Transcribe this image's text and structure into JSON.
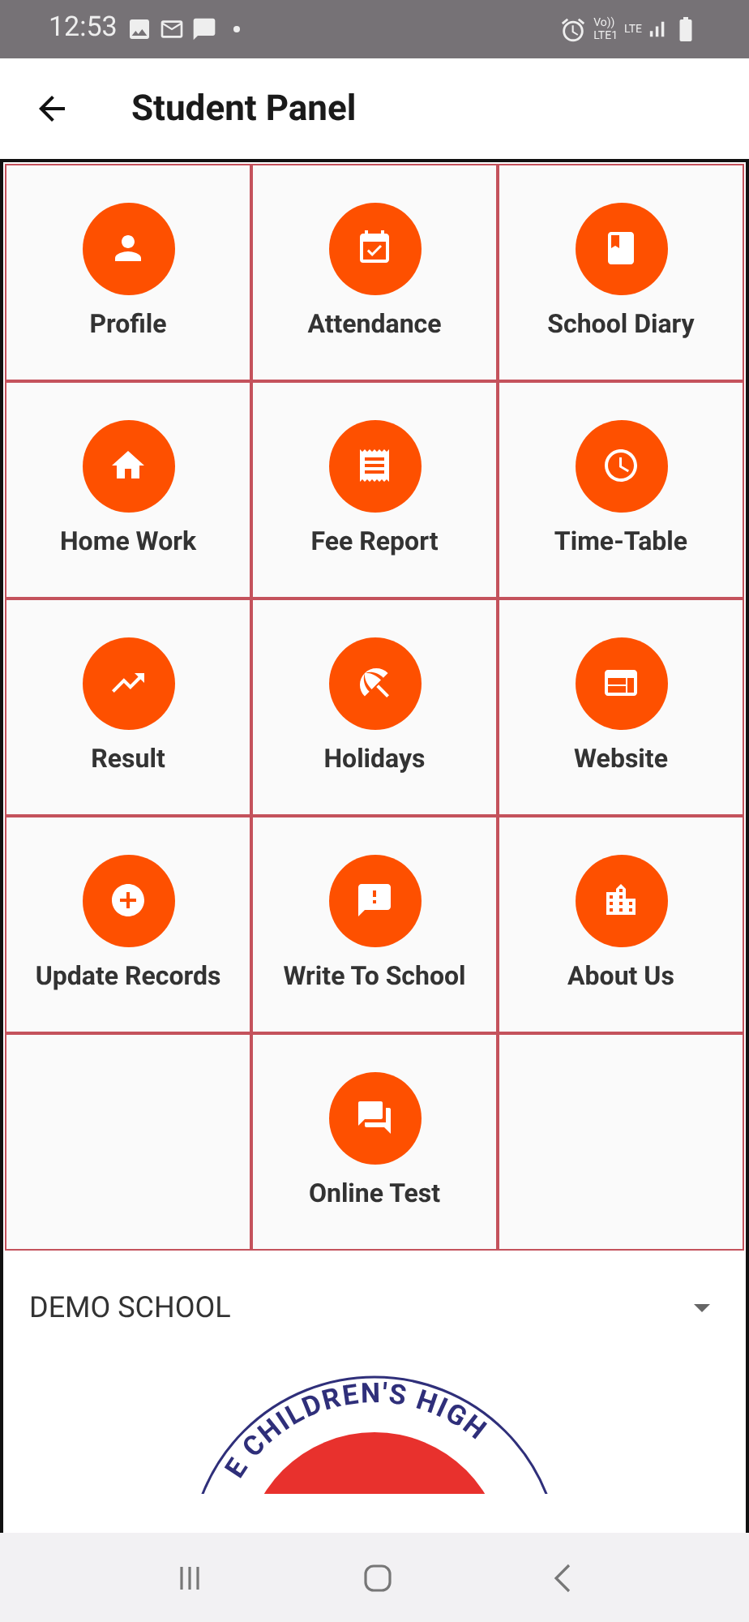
{
  "status_bar": {
    "time": "12:53",
    "network_1": "Vo))\nLTE1",
    "network_2": "LTE"
  },
  "header": {
    "title": "Student Panel"
  },
  "tiles": [
    {
      "label": "Profile"
    },
    {
      "label": "Attendance"
    },
    {
      "label": "School Diary"
    },
    {
      "label": "Home Work"
    },
    {
      "label": "Fee Report"
    },
    {
      "label": "Time-Table"
    },
    {
      "label": "Result"
    },
    {
      "label": "Holidays"
    },
    {
      "label": "Website"
    },
    {
      "label": "Update Records"
    },
    {
      "label": "Write To School"
    },
    {
      "label": "About Us"
    },
    {
      "label": "Online Test"
    }
  ],
  "school_select": {
    "value": "DEMO SCHOOL"
  },
  "logo": {
    "text": "E CHILDREN'S HIGH"
  }
}
